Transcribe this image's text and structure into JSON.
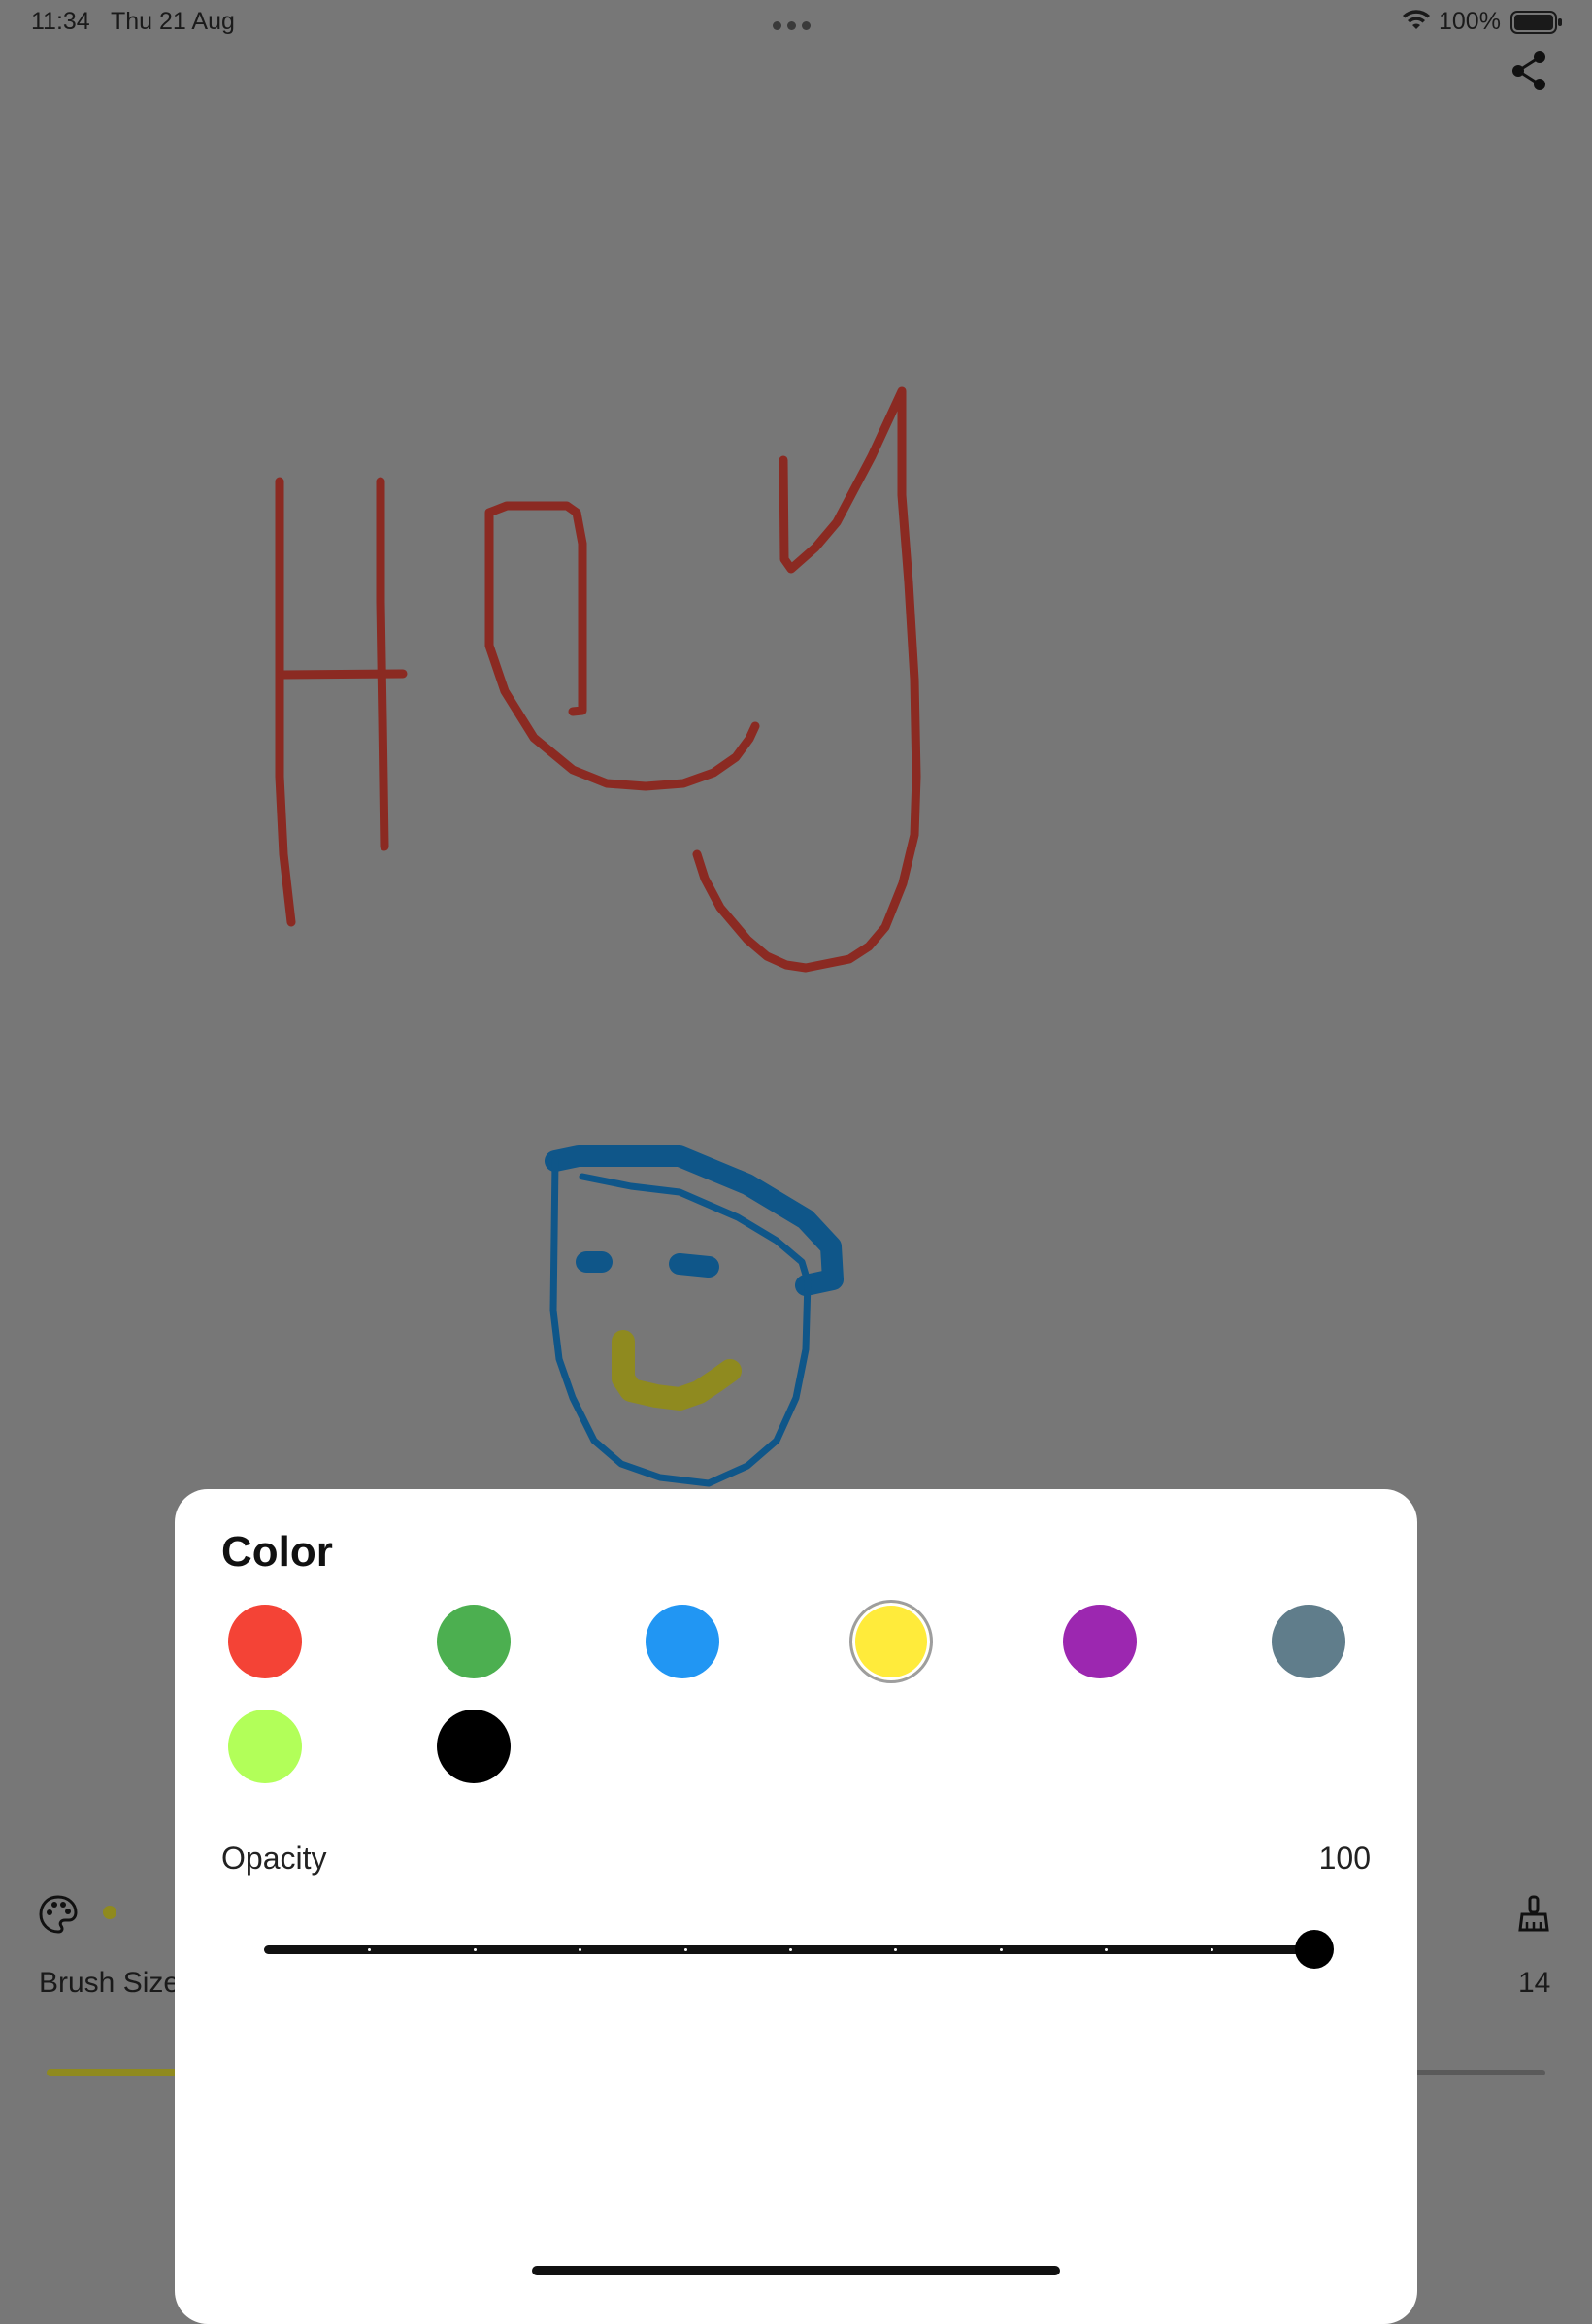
{
  "status_bar": {
    "time": "11:34",
    "date": "Thu 21 Aug",
    "battery": "100%"
  },
  "toolbar": {
    "share_icon": "share-icon",
    "palette_icon": "palette-icon",
    "eraser_icon": "brush-clean-icon",
    "current_color": "#8f8a1f",
    "brush_size_label": "Brush Size",
    "brush_size_value": "14"
  },
  "drawing": {
    "text_stroke_color": "#8b2a22",
    "face_stroke_color": "#0f5689",
    "smile_stroke_color": "#8f8a1f"
  },
  "color_sheet": {
    "title": "Color",
    "swatches": [
      {
        "name": "red",
        "color": "#f44336",
        "selected": false
      },
      {
        "name": "green",
        "color": "#4caf50",
        "selected": false
      },
      {
        "name": "blue",
        "color": "#2196f3",
        "selected": false
      },
      {
        "name": "yellow",
        "color": "#ffeb3b",
        "selected": true
      },
      {
        "name": "purple",
        "color": "#9c27b0",
        "selected": false
      },
      {
        "name": "blue-grey",
        "color": "#607d8b",
        "selected": false
      },
      {
        "name": "lime",
        "color": "#b2ff59",
        "selected": false
      },
      {
        "name": "black",
        "color": "#000000",
        "selected": false
      }
    ],
    "opacity_label": "Opacity",
    "opacity_value": "100",
    "opacity_fraction": 1.0
  }
}
